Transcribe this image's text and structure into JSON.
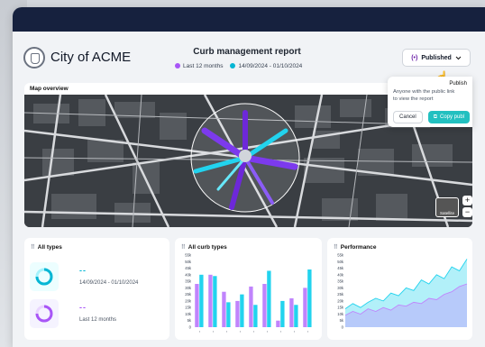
{
  "header": {
    "city_name": "City of ACME",
    "report_title": "Curb management report",
    "legend": [
      {
        "label": "Last 12 months",
        "color": "#a855f7"
      },
      {
        "label": "14/09/2024 - 01/10/2024",
        "color": "#06b6d4"
      }
    ],
    "publish_button": {
      "label": "Published",
      "icon": "broadcast-icon",
      "chevron": "chevron-down-icon"
    }
  },
  "popover": {
    "title": "Publish",
    "text_line1": "Anyone with the public link",
    "text_line2": "to view the report",
    "cancel_label": "Cancel",
    "copy_label": "Copy publ"
  },
  "map": {
    "label": "Map overview",
    "zoom_in": "+",
    "zoom_out": "−",
    "layer_label": "Satellite"
  },
  "cards": {
    "all_types": {
      "title": "All types",
      "stats": [
        {
          "value": "--",
          "caption": "14/09/2024 - 01/10/2024",
          "color": "#06b6d4"
        },
        {
          "value": "--",
          "caption": "Last 12 months",
          "color": "#a855f7"
        }
      ]
    },
    "all_curb_types": {
      "title": "All curb types"
    },
    "performance": {
      "title": "Performance"
    }
  },
  "chart_data": [
    {
      "type": "bar",
      "title": "All curb types",
      "yticks": [
        "55k",
        "50k",
        "45k",
        "40k",
        "35k",
        "30k",
        "25k",
        "20k",
        "15k",
        "10k",
        "5k",
        "0"
      ],
      "ylim": [
        0,
        55000
      ],
      "series": [
        {
          "color": "#c084fc",
          "values": [
            33000,
            40000,
            27000,
            20000,
            31000,
            33000,
            5000,
            22000,
            30000
          ]
        },
        {
          "color": "#22d3ee",
          "values": [
            40000,
            39000,
            19000,
            25000,
            17000,
            43000,
            20000,
            17000,
            44000
          ]
        }
      ],
      "categories": [
        "",
        "",
        "",
        "",
        "",
        "",
        "",
        "",
        ""
      ]
    },
    {
      "type": "area",
      "title": "Performance",
      "yticks": [
        "55k",
        "50k",
        "45k",
        "40k",
        "35k",
        "30k",
        "25k",
        "20k",
        "15k",
        "10k",
        "5k",
        "0"
      ],
      "ylim": [
        0,
        55000
      ],
      "series": [
        {
          "color": "#22d3ee",
          "values": [
            14000,
            18000,
            15000,
            19000,
            22000,
            20000,
            26000,
            24000,
            30000,
            28000,
            36000,
            33000,
            40000,
            37000,
            46000,
            43000,
            52000
          ]
        },
        {
          "color": "#c084fc",
          "values": [
            9000,
            12000,
            10000,
            14000,
            12000,
            15000,
            13000,
            17000,
            16000,
            19000,
            18000,
            22000,
            21000,
            25000,
            27000,
            31000,
            33000
          ]
        }
      ]
    }
  ]
}
